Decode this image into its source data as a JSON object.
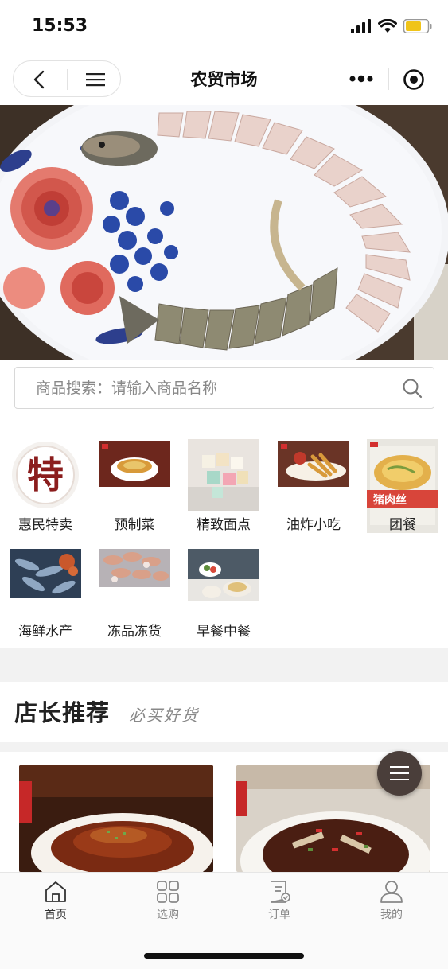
{
  "status": {
    "time": "15:53"
  },
  "nav": {
    "title": "农贸市场"
  },
  "search": {
    "placeholder": "商品搜索：请输入商品名称"
  },
  "categories": [
    {
      "label": "惠民特卖",
      "badge": "特"
    },
    {
      "label": "预制菜"
    },
    {
      "label": "精致面点"
    },
    {
      "label": "油炸小吃"
    },
    {
      "label": "团餐",
      "overlay_text": "猪肉丝"
    },
    {
      "label": "海鲜水产"
    },
    {
      "label": "冻品冻货"
    },
    {
      "label": "早餐中餐"
    }
  ],
  "section": {
    "title": "店长推荐",
    "subtitle": "必买好货"
  },
  "tabs": [
    {
      "label": "首页",
      "icon": "home-icon",
      "active": true
    },
    {
      "label": "选购",
      "icon": "grid-icon",
      "active": false
    },
    {
      "label": "订单",
      "icon": "order-icon",
      "active": false
    },
    {
      "label": "我的",
      "icon": "user-icon",
      "active": false
    }
  ],
  "colors": {
    "brand_red": "#8b1d1d",
    "accent_yellow": "#f0c419",
    "active_tab": "#333333",
    "inactive_tab": "#888888"
  }
}
